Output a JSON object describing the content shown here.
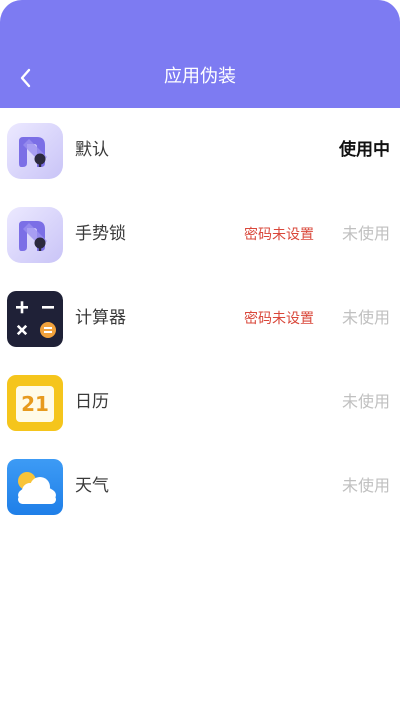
{
  "header": {
    "title": "应用伪装",
    "bg_color": "#7d7bf2"
  },
  "apps": [
    {
      "name": "默认",
      "icon": "app-lock-icon",
      "warning": "",
      "status": "使用中",
      "active": true
    },
    {
      "name": "手势锁",
      "icon": "app-lock-icon",
      "warning": "密码未设置",
      "status": "未使用",
      "active": false
    },
    {
      "name": "计算器",
      "icon": "calculator-icon",
      "warning": "密码未设置",
      "status": "未使用",
      "active": false
    },
    {
      "name": "日历",
      "icon": "calendar-icon",
      "icon_text": "21",
      "warning": "",
      "status": "未使用",
      "active": false
    },
    {
      "name": "天气",
      "icon": "weather-icon",
      "warning": "",
      "status": "未使用",
      "active": false
    }
  ],
  "colors": {
    "accent": "#7d7bf2",
    "warning": "#d9473a",
    "inactive": "#c0c0c0"
  }
}
